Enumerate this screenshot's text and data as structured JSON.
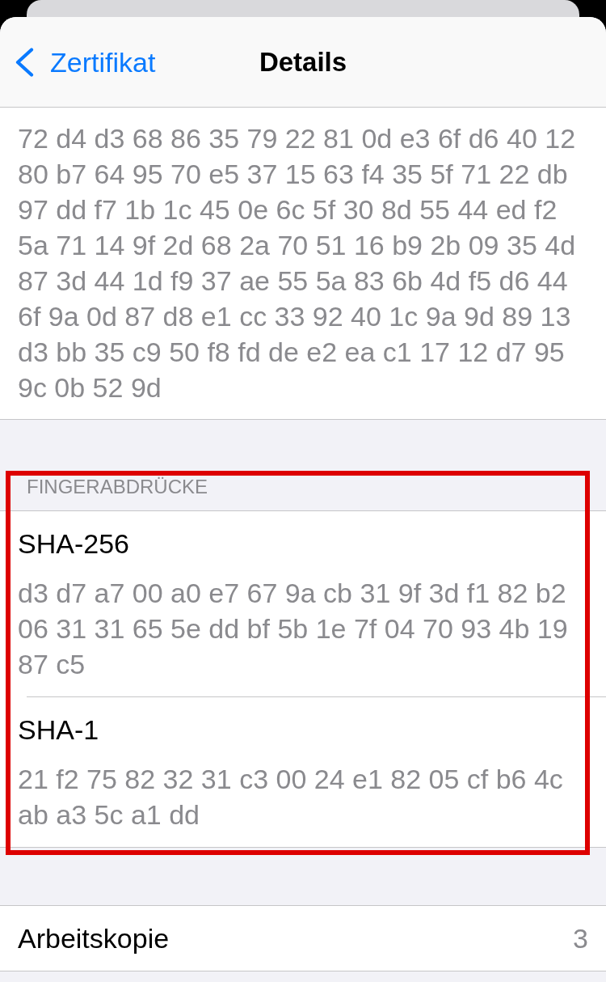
{
  "nav_bar": {
    "back_label": "Zertifikat",
    "title": "Details"
  },
  "data_block": {
    "value": "72 d4 d3 68 86 35 79 22 81 0d e3 6f d6 40 12 80 b7 64 95 70 e5 37 15 63 f4 35 5f 71 22 db 97 dd f7 1b 1c 45 0e 6c 5f 30 8d 55 44 ed f2 5a 71 14 9f 2d 68 2a 70 51 16 b9 2b 09 35 4d 87 3d 44 1d f9 37 ae 55 5a 83 6b 4d f5 d6 44 6f 9a 0d 87 d8 e1 cc 33 92 40 1c 9a 9d 89 13 d3 bb 35 c9 50 f8 fd de e2 ea c1 17 12 d7 95 9c 0b 52 9d"
  },
  "fingerprints": {
    "header": "FINGERABDRÜCKE",
    "highlighted": true,
    "items": [
      {
        "label": "SHA-256",
        "value": "d3 d7 a7 00 a0 e7 67 9a cb 31 9f 3d f1 82 b2 06 31 31 65 5e dd bf 5b 1e 7f 04 70 93 4b 19 87 c5"
      },
      {
        "label": "SHA-1",
        "value": "21 f2 75 82 32 31 c3 00 24 e1 82 05 cf b6 4c ab a3 5c a1 dd"
      }
    ]
  },
  "rows": [
    {
      "label": "Arbeitskopie",
      "value": "3"
    }
  ]
}
